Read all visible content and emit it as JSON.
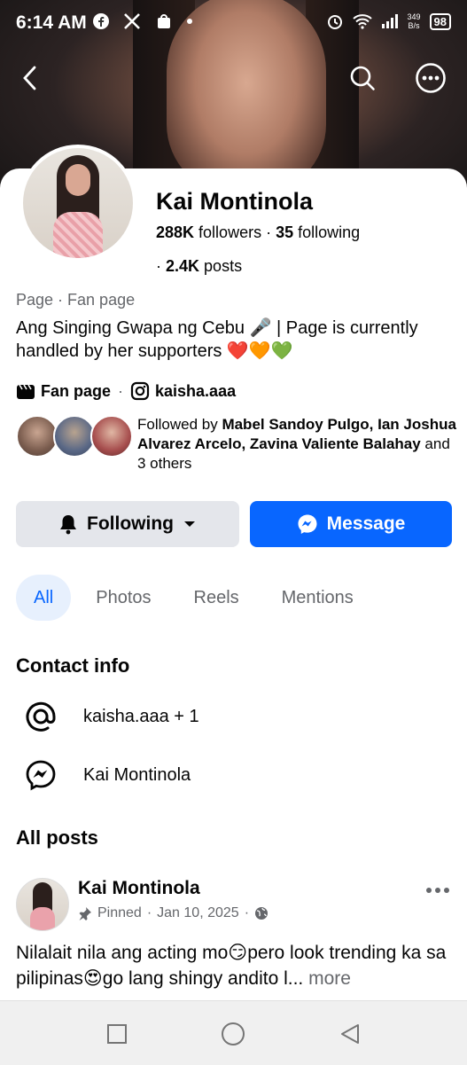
{
  "status_bar": {
    "time": "6:14 AM",
    "speed_value": "349",
    "speed_unit": "B/s",
    "battery": "98"
  },
  "profile": {
    "name": "Kai Montinola",
    "followers_count": "288K",
    "followers_label": "followers",
    "following_count": "35",
    "following_label": "following",
    "posts_count": "2.4K",
    "posts_label": "posts",
    "category": "Page · Fan page",
    "bio": "Ang Singing Gwapa ng Cebu 🎤 | Page is currently handled by her supporters ❤️🧡💚",
    "link_type": "Fan page",
    "instagram": "kaisha.aaa"
  },
  "mutual": {
    "prefix": "Followed by ",
    "names": "Mabel Sandoy Pulgo, Ian Joshua Alvarez Arcelo, Zavina Valiente Balahay",
    "suffix": " and 3 others",
    "avatar_colors": [
      "#9a7b6a",
      "#7d8aa5",
      "#c46a6a"
    ]
  },
  "actions": {
    "following_label": "Following",
    "message_label": "Message"
  },
  "tabs": [
    {
      "label": "All",
      "active": true
    },
    {
      "label": "Photos",
      "active": false
    },
    {
      "label": "Reels",
      "active": false
    },
    {
      "label": "Mentions",
      "active": false
    }
  ],
  "contact": {
    "title": "Contact info",
    "items": [
      {
        "icon": "at-icon",
        "text": "kaisha.aaa + 1"
      },
      {
        "icon": "messenger-icon",
        "text": "Kai Montinola"
      }
    ]
  },
  "posts": {
    "title": "All posts",
    "first": {
      "author": "Kai Montinola",
      "pinned": "Pinned",
      "date": "Jan 10, 2025",
      "text": "Nilalait nila ang acting mo😏pero look trending ka sa pilipinas😍go lang shingy andito l...",
      "more": "more"
    }
  },
  "colors": {
    "accent": "#0866ff",
    "tab_active_bg": "#e7f0fd",
    "button_gray": "#e4e6eb",
    "secondary_text": "#65676b"
  }
}
